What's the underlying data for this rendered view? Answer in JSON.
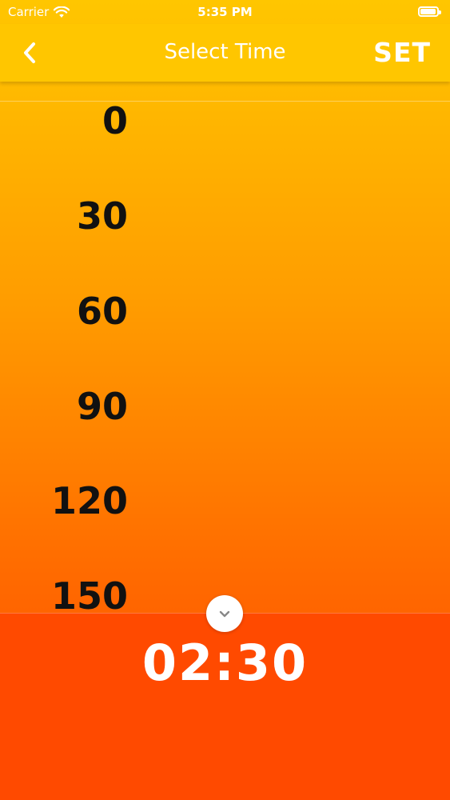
{
  "status_bar": {
    "carrier": "Carrier",
    "time": "5:35 PM",
    "icons": [
      "wifi-icon",
      "battery-icon"
    ]
  },
  "nav_bar": {
    "title": "Select Time",
    "set_label": "SET",
    "back_icon": "chevron-left-icon"
  },
  "picker": {
    "items": [
      "0",
      "30",
      "60",
      "90",
      "120",
      "150"
    ]
  },
  "bottom_panel": {
    "collapse_icon": "chevron-down-icon",
    "selected_time": "02:30"
  },
  "colors": {
    "gradient_top": "#FFC600",
    "gradient_bottom": "#FF4A00",
    "text_dark": "#111111",
    "text_light": "#FFFFFF"
  }
}
